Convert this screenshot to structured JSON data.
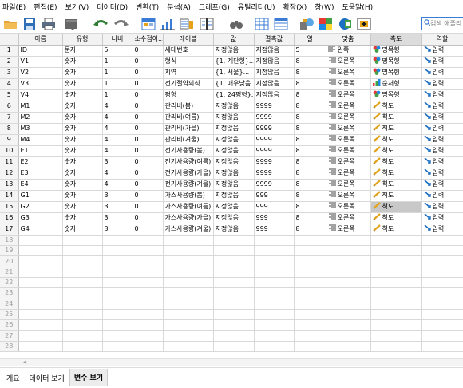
{
  "menu": [
    "파일(E)",
    "편집(E)",
    "보기(V)",
    "데이터(D)",
    "변환(T)",
    "분석(A)",
    "그래프(G)",
    "유틸리티(U)",
    "확장(X)",
    "창(W)",
    "도움말(H)"
  ],
  "search": {
    "placeholder": "검색 애플리"
  },
  "columns": [
    "이름",
    "유형",
    "너비",
    "소수점이...",
    "레이블",
    "값",
    "결측값",
    "열",
    "맞춤",
    "측도",
    "역할"
  ],
  "rows": [
    {
      "num": "1",
      "name": "ID",
      "type": "문자",
      "width": "5",
      "dec": "0",
      "label": "세대번호",
      "values": "지정않음",
      "missing": "지정않음",
      "cols": "5",
      "align": "왼쪽",
      "align_icon": "align-left-icon",
      "measure": "명목형",
      "measure_icon": "nominal-icon",
      "role": "입력"
    },
    {
      "num": "2",
      "name": "V1",
      "type": "숫자",
      "width": "1",
      "dec": "0",
      "label": "형식",
      "values": "{1, 계단형}...",
      "missing": "지정않음",
      "cols": "8",
      "align": "오른쪽",
      "align_icon": "align-right-icon",
      "measure": "명목형",
      "measure_icon": "nominal-icon",
      "role": "입력"
    },
    {
      "num": "3",
      "name": "V2",
      "type": "숫자",
      "width": "1",
      "dec": "0",
      "label": "지역",
      "values": "{1, 서울}...",
      "missing": "지정않음",
      "cols": "8",
      "align": "오른쪽",
      "align_icon": "align-right-icon",
      "measure": "명목형",
      "measure_icon": "nominal-icon",
      "role": "입력"
    },
    {
      "num": "4",
      "name": "V3",
      "type": "숫자",
      "width": "1",
      "dec": "0",
      "label": "전기절약의식",
      "values": "{1, 매우낮음...",
      "missing": "지정않음",
      "cols": "8",
      "align": "오른쪽",
      "align_icon": "align-right-icon",
      "measure": "순서형",
      "measure_icon": "ordinal-icon",
      "role": "입력"
    },
    {
      "num": "5",
      "name": "V4",
      "type": "숫자",
      "width": "1",
      "dec": "0",
      "label": "평형",
      "values": "{1, 24평형}...",
      "missing": "지정않음",
      "cols": "8",
      "align": "오른쪽",
      "align_icon": "align-right-icon",
      "measure": "명목형",
      "measure_icon": "nominal-icon",
      "role": "입력"
    },
    {
      "num": "6",
      "name": "M1",
      "type": "숫자",
      "width": "4",
      "dec": "0",
      "label": "관리비(봄)",
      "values": "지정않음",
      "missing": "9999",
      "cols": "8",
      "align": "오른쪽",
      "align_icon": "align-right-icon",
      "measure": "척도",
      "measure_icon": "scale-icon",
      "role": "입력"
    },
    {
      "num": "7",
      "name": "M2",
      "type": "숫자",
      "width": "4",
      "dec": "0",
      "label": "관리비(여름)",
      "values": "지정않음",
      "missing": "9999",
      "cols": "8",
      "align": "오른쪽",
      "align_icon": "align-right-icon",
      "measure": "척도",
      "measure_icon": "scale-icon",
      "role": "입력"
    },
    {
      "num": "8",
      "name": "M3",
      "type": "숫자",
      "width": "4",
      "dec": "0",
      "label": "관리비(가을)",
      "values": "지정않음",
      "missing": "9999",
      "cols": "8",
      "align": "오른쪽",
      "align_icon": "align-right-icon",
      "measure": "척도",
      "measure_icon": "scale-icon",
      "role": "입력"
    },
    {
      "num": "9",
      "name": "M4",
      "type": "숫자",
      "width": "4",
      "dec": "0",
      "label": "관리비(겨울)",
      "values": "지정않음",
      "missing": "9999",
      "cols": "8",
      "align": "오른쪽",
      "align_icon": "align-right-icon",
      "measure": "척도",
      "measure_icon": "scale-icon",
      "role": "입력"
    },
    {
      "num": "10",
      "name": "E1",
      "type": "숫자",
      "width": "4",
      "dec": "0",
      "label": "전기사용량(봄)",
      "values": "지정않음",
      "missing": "9999",
      "cols": "8",
      "align": "오른쪽",
      "align_icon": "align-right-icon",
      "measure": "척도",
      "measure_icon": "scale-icon",
      "role": "입력"
    },
    {
      "num": "11",
      "name": "E2",
      "type": "숫자",
      "width": "3",
      "dec": "0",
      "label": "전기사용량(여름)",
      "values": "지정않음",
      "missing": "9999",
      "cols": "8",
      "align": "오른쪽",
      "align_icon": "align-right-icon",
      "measure": "척도",
      "measure_icon": "scale-icon",
      "role": "입력"
    },
    {
      "num": "12",
      "name": "E3",
      "type": "숫자",
      "width": "4",
      "dec": "0",
      "label": "전기사용량(가을)",
      "values": "지정않음",
      "missing": "9999",
      "cols": "8",
      "align": "오른쪽",
      "align_icon": "align-right-icon",
      "measure": "척도",
      "measure_icon": "scale-icon",
      "role": "입력"
    },
    {
      "num": "13",
      "name": "E4",
      "type": "숫자",
      "width": "4",
      "dec": "0",
      "label": "전기사용량(겨울)",
      "values": "지정않음",
      "missing": "9999",
      "cols": "8",
      "align": "오른쪽",
      "align_icon": "align-right-icon",
      "measure": "척도",
      "measure_icon": "scale-icon",
      "role": "입력"
    },
    {
      "num": "14",
      "name": "G1",
      "type": "숫자",
      "width": "3",
      "dec": "0",
      "label": "가스사용량(봄)",
      "values": "지정않음",
      "missing": "999",
      "cols": "8",
      "align": "오른쪽",
      "align_icon": "align-right-icon",
      "measure": "척도",
      "measure_icon": "scale-icon",
      "role": "입력"
    },
    {
      "num": "15",
      "name": "G2",
      "type": "숫자",
      "width": "3",
      "dec": "0",
      "label": "가스사용량(여름)",
      "values": "지정않음",
      "missing": "999",
      "cols": "8",
      "align": "오른쪽",
      "align_icon": "align-right-icon",
      "measure": "척도",
      "measure_icon": "scale-icon",
      "role": "입력"
    },
    {
      "num": "16",
      "name": "G3",
      "type": "숫자",
      "width": "3",
      "dec": "0",
      "label": "가스사용량(가을)",
      "values": "지정않음",
      "missing": "999",
      "cols": "8",
      "align": "오른쪽",
      "align_icon": "align-right-icon",
      "measure": "척도",
      "measure_icon": "scale-icon",
      "role": "입력"
    },
    {
      "num": "17",
      "name": "G4",
      "type": "숫자",
      "width": "3",
      "dec": "0",
      "label": "가스사용량(겨울)",
      "values": "지정않음",
      "missing": "999",
      "cols": "8",
      "align": "오른쪽",
      "align_icon": "align-right-icon",
      "measure": "척도",
      "measure_icon": "scale-icon",
      "role": "입력"
    }
  ],
  "empty_rows": [
    "18",
    "19",
    "20",
    "21",
    "22",
    "23",
    "24",
    "25",
    "26",
    "27",
    "28"
  ],
  "tabs": [
    "개요",
    "데이터 보기",
    "변수 보기"
  ],
  "active_tab": "변수 보기",
  "colors": {
    "accent": "#3a7bd5",
    "selected_cell": "#c8c8c8",
    "header_bg": "#f2f2f2"
  }
}
